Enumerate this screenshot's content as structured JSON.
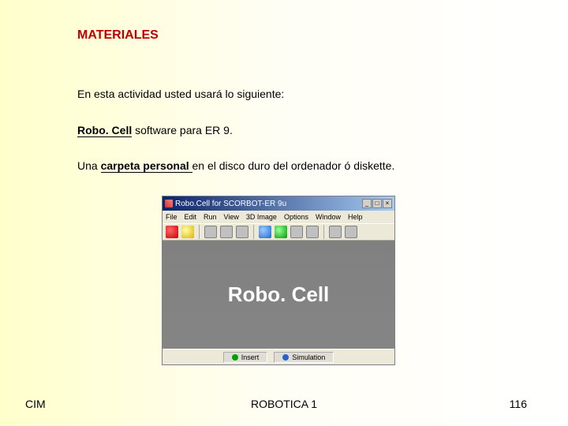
{
  "heading": "MATERIALES",
  "intro": "En esta actividad usted usará lo siguiente:",
  "line2_pre": "Robo. Cell",
  "line2_rest": " software para ER 9.",
  "line3_pre": "Una ",
  "line3_emph": "carpeta personal ",
  "line3_rest": "en el disco duro del ordenador ó diskette.",
  "window": {
    "title": "Robo.Cell for SCORBOT-ER 9u",
    "menu": [
      "File",
      "Edit",
      "Run",
      "View",
      "3D Image",
      "Options",
      "Window",
      "Help"
    ],
    "logo": "Robo. Cell",
    "status": {
      "a": "Insert",
      "b": "Simulation"
    },
    "ctrl_min": "_",
    "ctrl_max": "□",
    "ctrl_close": "×"
  },
  "footer": {
    "left": "CIM",
    "center": "ROBOTICA 1",
    "right": "116"
  }
}
